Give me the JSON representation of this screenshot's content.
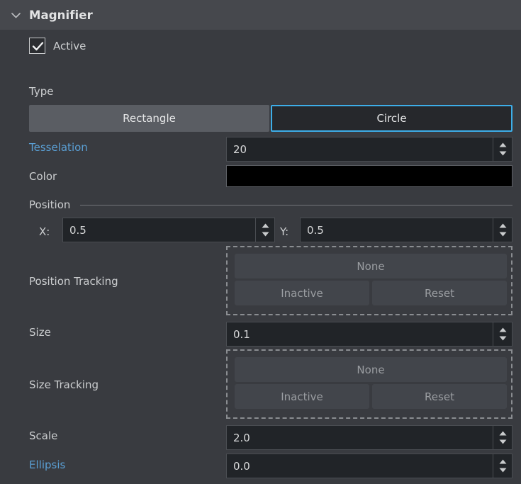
{
  "header": {
    "title": "Magnifier",
    "collapse_icon": "chevron-down-icon",
    "expanded": true
  },
  "active": {
    "label": "Active",
    "checked": true,
    "check_icon": "checkmark-icon"
  },
  "type": {
    "label": "Type",
    "options": [
      "Rectangle",
      "Circle"
    ],
    "selected": "Circle",
    "selected_index": 1
  },
  "fields": {
    "tesselation": {
      "label": "Tesselation",
      "value": "20",
      "animated": true
    },
    "color": {
      "label": "Color",
      "value": "#000000"
    },
    "size": {
      "label": "Size",
      "value": "0.1",
      "animated": false
    },
    "scale": {
      "label": "Scale",
      "value": "2.0",
      "animated": false
    },
    "ellipsis": {
      "label": "Ellipsis",
      "value": "0.0",
      "animated": true
    }
  },
  "position": {
    "group_label": "Position",
    "x_label": "X:",
    "x_value": "0.5",
    "y_label": "Y:",
    "y_value": "0.5"
  },
  "position_tracking": {
    "label": "Position Tracking",
    "source_button": "None",
    "state_button": "Inactive",
    "reset_button": "Reset"
  },
  "size_tracking": {
    "label": "Size Tracking",
    "source_button": "None",
    "state_button": "Inactive",
    "reset_button": "Reset"
  },
  "colors": {
    "panel_bg": "#393b40",
    "header_bg": "#46484d",
    "accent_selected": "#3daee9",
    "animated_label": "#5a9fd4",
    "field_bg": "#212428",
    "swatch": "#000000"
  },
  "icons": {
    "spin_up": "triangle-up-icon",
    "spin_down": "triangle-down-icon"
  }
}
